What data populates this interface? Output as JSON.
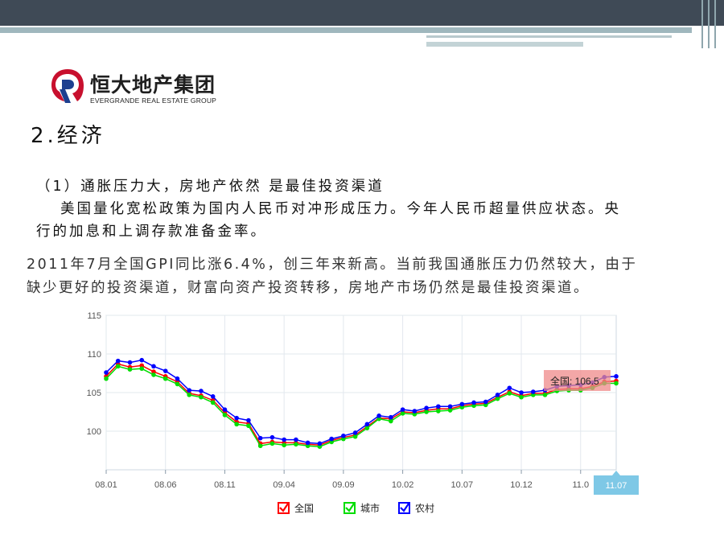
{
  "header": {
    "accent_dark": "#3f4a56",
    "accent_teal": "#9fb7bd"
  },
  "logo": {
    "name_cn": "恒大地产集团",
    "name_en": "EVERGRANDE REAL ESTATE GROUP",
    "mark_color": "#c8102e"
  },
  "section": {
    "title": "2.经济",
    "subheading": "（1）通胀压力大，房地产依然 是最佳投资渠道",
    "line1": "美国量化宽松政策为国内人民币对冲形成压力。今年人民币超量供应状态。央",
    "line2": "行的加息和上调存款准备金率。",
    "line3": "2011年7月全国GPI同比涨6.4%，创三年来新高。当前我国通胀压力仍然较大，由于",
    "line4": "缺少更好的投资渠道，财富向资产投资转移，房地产市场仍然是最佳投资渠道。"
  },
  "chart_data": {
    "type": "line",
    "ylim": [
      95,
      115
    ],
    "yticks": [
      100,
      105,
      110,
      115
    ],
    "xtick_labels": [
      "08.01",
      "08.06",
      "08.11",
      "09.04",
      "09.09",
      "10.02",
      "10.07",
      "10.12",
      "11.0"
    ],
    "highlight_label": "11.07",
    "tooltip": "全国: 106.5",
    "grid": true,
    "legend_position": "bottom",
    "series": [
      {
        "name": "全国",
        "color": "#ff0000",
        "values": [
          107.1,
          108.7,
          108.3,
          108.5,
          107.7,
          107.1,
          106.4,
          104.9,
          104.6,
          104.0,
          102.4,
          101.2,
          101.0,
          98.4,
          98.6,
          98.5,
          98.5,
          98.3,
          98.2,
          98.8,
          99.2,
          99.5,
          100.6,
          101.7,
          101.6,
          102.5,
          102.4,
          102.7,
          102.9,
          102.9,
          103.3,
          103.5,
          103.6,
          104.4,
          105.1,
          104.6,
          104.9,
          104.9,
          105.4,
          105.5,
          105.5,
          105.8,
          106.4,
          106.5
        ]
      },
      {
        "name": "城市",
        "color": "#00dd00",
        "values": [
          106.8,
          108.4,
          108.0,
          108.1,
          107.3,
          106.8,
          106.1,
          104.7,
          104.4,
          103.7,
          102.1,
          100.9,
          100.7,
          98.1,
          98.4,
          98.2,
          98.3,
          98.1,
          98.0,
          98.6,
          99.0,
          99.3,
          100.4,
          101.6,
          101.3,
          102.3,
          102.2,
          102.5,
          102.6,
          102.7,
          103.1,
          103.3,
          103.4,
          104.2,
          104.9,
          104.4,
          104.7,
          104.7,
          105.2,
          105.3,
          105.3,
          105.6,
          106.2,
          106.2
        ]
      },
      {
        "name": "农村",
        "color": "#0000ff",
        "values": [
          107.6,
          109.1,
          108.9,
          109.2,
          108.4,
          107.8,
          106.8,
          105.3,
          105.2,
          104.5,
          102.8,
          101.7,
          101.4,
          99.1,
          99.2,
          98.9,
          98.9,
          98.5,
          98.4,
          99.0,
          99.4,
          99.8,
          100.9,
          102.0,
          101.8,
          102.8,
          102.6,
          103.0,
          103.2,
          103.2,
          103.5,
          103.7,
          103.8,
          104.7,
          105.6,
          105.0,
          105.1,
          105.3,
          105.8,
          105.9,
          106.0,
          106.3,
          107.0,
          107.1
        ]
      }
    ]
  }
}
